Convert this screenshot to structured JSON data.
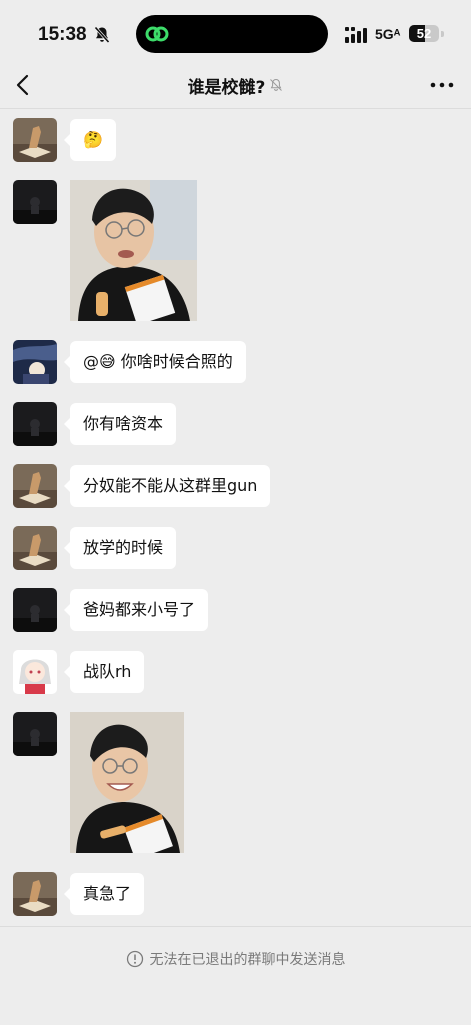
{
  "status": {
    "time": "15:38",
    "network": "5Gᴬ",
    "battery": "52",
    "battery_level": 0.52
  },
  "header": {
    "title": "谁是校雠?"
  },
  "messages": [
    {
      "type": "text",
      "text": "🤔"
    },
    {
      "type": "image",
      "alt": ""
    },
    {
      "type": "text",
      "text": "@😅 你啥时候合照的"
    },
    {
      "type": "text",
      "text": "你有啥资本"
    },
    {
      "type": "text",
      "text": "分奴能不能从这群里gun"
    },
    {
      "type": "text",
      "text": "放学的时候"
    },
    {
      "type": "text",
      "text": "爸妈都来小号了"
    },
    {
      "type": "text",
      "text": "战队rh"
    },
    {
      "type": "image",
      "alt": ""
    },
    {
      "type": "text",
      "text": "真急了"
    }
  ],
  "footer": {
    "notice": "无法在已退出的群聊中发送消息"
  },
  "colors": {
    "background": "#ededed",
    "bubble": "#ffffff",
    "text": "#111111",
    "muted": "#7a7a7a"
  }
}
